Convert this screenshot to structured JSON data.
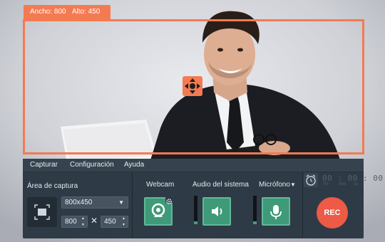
{
  "capture": {
    "width_label": "Ancho: 800",
    "height_label": "Alto: 450"
  },
  "menu": {
    "capture": "Capturar",
    "settings": "Configuración",
    "help": "Ayuda"
  },
  "area": {
    "title": "Área de captura",
    "preset": "800x450",
    "width": "800",
    "times": "✕",
    "height": "450"
  },
  "sources": {
    "webcam": "Webcam",
    "system_audio": "Audio del sistema",
    "microphone": "Micrófono",
    "system_audio_level": 0.1,
    "microphone_level": 0.1
  },
  "timer": {
    "value": "00 : 00 : 00",
    "units": [
      "hh",
      "mm",
      "ss"
    ]
  },
  "rec_label": "REC",
  "colors": {
    "accent": "#f47a52",
    "panel": "#2e3a45",
    "green": "#3e9a79",
    "rec": "#ed5a46"
  }
}
